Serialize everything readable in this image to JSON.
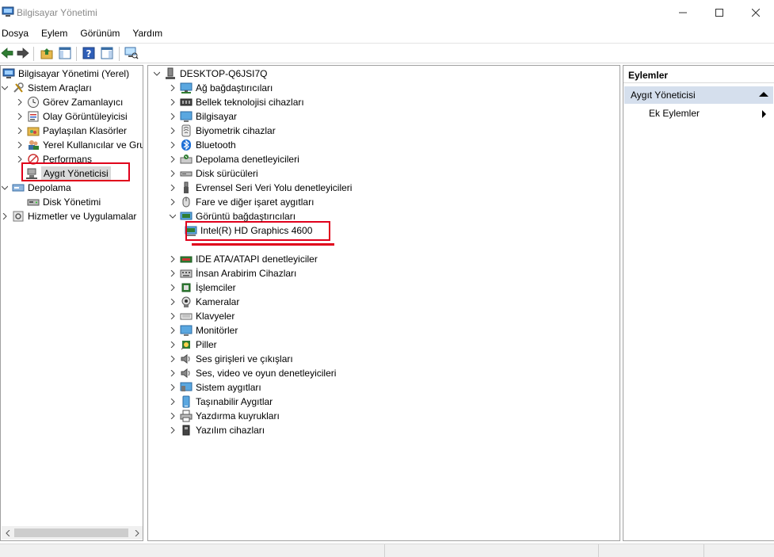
{
  "window": {
    "title": "Bilgisayar Yönetimi",
    "icon": "computer-management-icon"
  },
  "menu": [
    "Dosya",
    "Eylem",
    "Görünüm",
    "Yardım"
  ],
  "left_tree": [
    {
      "label": "Bilgisayar Yönetimi (Yerel)",
      "icon": "computer-management-icon"
    },
    {
      "label": "Sistem Araçları",
      "icon": "tools-icon"
    },
    {
      "label": "Görev Zamanlayıcı",
      "icon": "clock-icon"
    },
    {
      "label": "Olay Görüntüleyicisi",
      "icon": "event-viewer-icon"
    },
    {
      "label": "Paylaşılan Klasörler",
      "icon": "shared-folder-icon"
    },
    {
      "label": "Yerel Kullanıcılar ve Gru",
      "icon": "users-icon"
    },
    {
      "label": "Performans",
      "icon": "performance-icon"
    },
    {
      "label": "Aygıt Yöneticisi",
      "icon": "device-manager-icon"
    },
    {
      "label": "Depolama",
      "icon": "storage-icon"
    },
    {
      "label": "Disk Yönetimi",
      "icon": "disk-icon"
    },
    {
      "label": "Hizmetler ve Uygulamalar",
      "icon": "services-icon"
    }
  ],
  "device_tree": {
    "root": {
      "label": "DESKTOP-Q6JSI7Q",
      "icon": "computer-icon"
    },
    "categories_top": [
      {
        "label": "Ağ bağdaştırıcıları",
        "icon": "network-icon"
      },
      {
        "label": "Bellek teknolojisi cihazları",
        "icon": "memory-icon"
      },
      {
        "label": "Bilgisayar",
        "icon": "monitor-icon"
      },
      {
        "label": "Biyometrik cihazlar",
        "icon": "biometric-icon"
      },
      {
        "label": "Bluetooth",
        "icon": "bluetooth-icon"
      },
      {
        "label": "Depolama denetleyicileri",
        "icon": "storage-controller-icon"
      },
      {
        "label": "Disk sürücüleri",
        "icon": "disk-drive-icon"
      },
      {
        "label": "Evrensel Seri Veri Yolu denetleyicileri",
        "icon": "usb-icon"
      },
      {
        "label": "Fare ve diğer işaret aygıtları",
        "icon": "mouse-icon"
      },
      {
        "label": "Görüntü bağdaştırıcıları",
        "icon": "display-adapter-icon"
      }
    ],
    "expanded_child": {
      "label": "Intel(R) HD Graphics 4600",
      "icon": "display-adapter-icon"
    },
    "categories_bottom": [
      {
        "label": "IDE ATA/ATAPI denetleyiciler",
        "icon": "ide-icon"
      },
      {
        "label": "İnsan Arabirim Cihazları",
        "icon": "hid-icon"
      },
      {
        "label": "İşlemciler",
        "icon": "processor-icon"
      },
      {
        "label": "Kameralar",
        "icon": "camera-icon"
      },
      {
        "label": "Klavyeler",
        "icon": "keyboard-icon"
      },
      {
        "label": "Monitörler",
        "icon": "monitor-icon"
      },
      {
        "label": "Piller",
        "icon": "battery-icon"
      },
      {
        "label": "Ses girişleri ve çıkışları",
        "icon": "speaker-icon"
      },
      {
        "label": "Ses, video ve oyun denetleyicileri",
        "icon": "speaker-icon"
      },
      {
        "label": "Sistem aygıtları",
        "icon": "system-devices-icon"
      },
      {
        "label": "Taşınabilir Aygıtlar",
        "icon": "portable-device-icon"
      },
      {
        "label": "Yazdırma kuyrukları",
        "icon": "printer-icon"
      },
      {
        "label": "Yazılım cihazları",
        "icon": "software-device-icon"
      }
    ]
  },
  "actions": {
    "header": "Eylemler",
    "section": "Aygıt Yöneticisi",
    "item": "Ek Eylemler"
  },
  "colors": {
    "highlight": "#e0001b",
    "selection": "#d9d9d9",
    "actions_section": "#d5dfed"
  }
}
